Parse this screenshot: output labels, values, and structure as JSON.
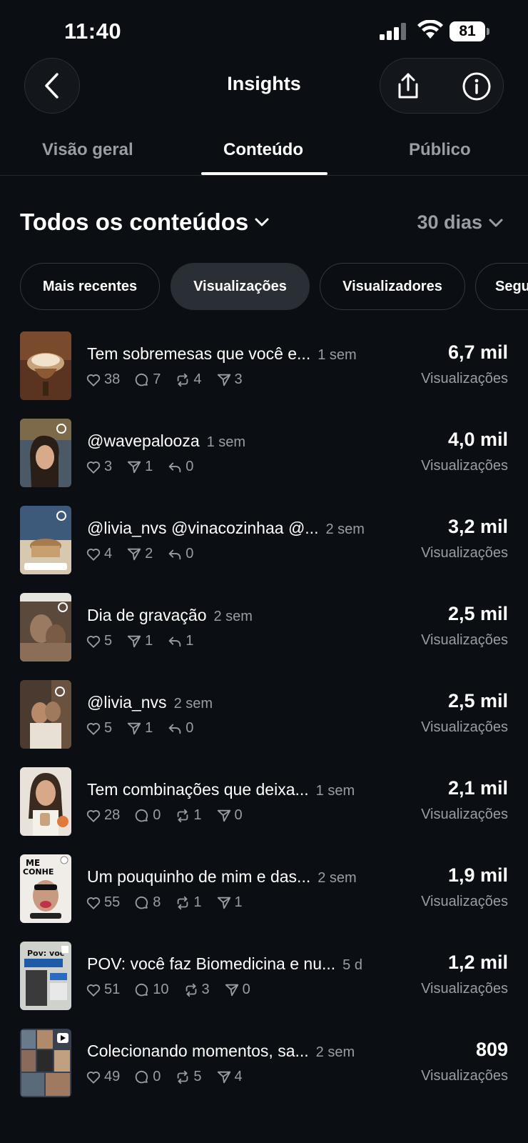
{
  "status_bar": {
    "time": "11:40",
    "battery": "81"
  },
  "header": {
    "title": "Insights"
  },
  "tabs": [
    {
      "label": "Visão geral"
    },
    {
      "label": "Conteúdo"
    },
    {
      "label": "Público"
    }
  ],
  "section": {
    "title": "Todos os conteúdos",
    "period": "30 dias"
  },
  "filters": [
    {
      "label": "Mais recentes"
    },
    {
      "label": "Visualizações"
    },
    {
      "label": "Visualizadores"
    },
    {
      "label": "Segu"
    }
  ],
  "posts": [
    {
      "text": "Tem sobremesas que você e...",
      "time": "1 sem",
      "stats": [
        "38",
        "7",
        "4",
        "3"
      ],
      "views": "6,7 mil",
      "views_label": "Visualizações"
    },
    {
      "text": "@wavepalooza",
      "time": "1 sem",
      "stats": [
        "3",
        "1",
        "0"
      ],
      "views": "4,0 mil",
      "views_label": "Visualizações"
    },
    {
      "text": "@livia_nvs @vinacozinhaa @...",
      "time": "2 sem",
      "stats": [
        "4",
        "2",
        "0"
      ],
      "views": "3,2 mil",
      "views_label": "Visualizações"
    },
    {
      "text": "Dia de gravação",
      "time": "2 sem",
      "stats": [
        "5",
        "1",
        "1"
      ],
      "views": "2,5 mil",
      "views_label": "Visualizações"
    },
    {
      "text": "@livia_nvs",
      "time": "2 sem",
      "stats": [
        "5",
        "1",
        "0"
      ],
      "views": "2,5 mil",
      "views_label": "Visualizações"
    },
    {
      "text": "Tem combinações que deixa...",
      "time": "1 sem",
      "stats": [
        "28",
        "0",
        "1",
        "0"
      ],
      "views": "2,1 mil",
      "views_label": "Visualizações"
    },
    {
      "text": "Um pouquinho de mim e das...",
      "time": "2 sem",
      "stats": [
        "55",
        "8",
        "1",
        "1"
      ],
      "views": "1,9 mil",
      "views_label": "Visualizações"
    },
    {
      "text": "POV: você faz Biomedicina e nu...",
      "time": "5 d",
      "stats": [
        "51",
        "10",
        "3",
        "0"
      ],
      "views": "1,2 mil",
      "views_label": "Visualizações"
    },
    {
      "text": "Colecionando momentos, sa...",
      "time": "2 sem",
      "stats": [
        "49",
        "0",
        "5",
        "4"
      ],
      "views": "809",
      "views_label": "Visualizações"
    }
  ]
}
